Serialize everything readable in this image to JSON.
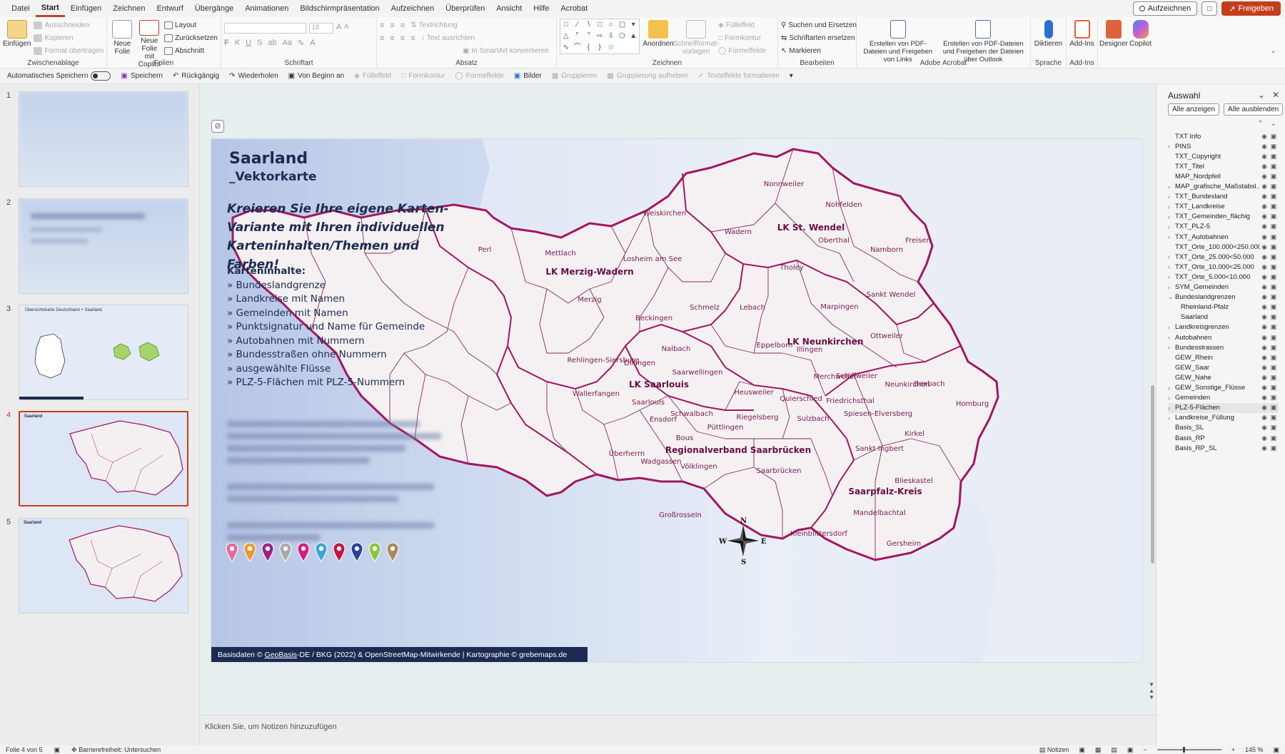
{
  "menu": {
    "tabs": [
      "Datei",
      "Start",
      "Einfügen",
      "Zeichnen",
      "Entwurf",
      "Übergänge",
      "Animationen",
      "Bildschirmpräsentation",
      "Aufzeichnen",
      "Überprüfen",
      "Ansicht",
      "Hilfe",
      "Acrobat"
    ],
    "active_tab": "Start",
    "record_label": "Aufzeichnen",
    "share_label": "Freigeben"
  },
  "ribbon": {
    "clipboard": {
      "paste": "Einfügen",
      "cut": "Ausschneiden",
      "copy": "Kopieren",
      "format_painter": "Format übertragen",
      "group": "Zwischenablage"
    },
    "slides": {
      "new_slide": "Neue Folie",
      "new_slide_copilot": "Neue Folie mit Copilot",
      "layout": "Layout",
      "reset": "Zurücksetzen",
      "section": "Abschnitt",
      "group": "Folien"
    },
    "font": {
      "size": "18",
      "group": "Schriftart"
    },
    "paragraph": {
      "text_direction": "Textrichtung",
      "align_text": "Text ausrichten",
      "smartart": "In SmartArt konvertieren",
      "group": "Absatz"
    },
    "drawing": {
      "arrange": "Anordnen",
      "quick_styles": "Schnellformat-vorlagen",
      "fill": "Fülleffekt",
      "outline": "Formkontur",
      "effects": "Formeffekte",
      "group": "Zeichnen"
    },
    "editing": {
      "find_replace": "Suchen und Ersetzen",
      "replace_fonts": "Schriftarten ersetzen",
      "select": "Markieren",
      "group": "Bearbeiten"
    },
    "acrobat": {
      "pdf_links": "Erstellen von PDF-Dateien und Freigeben von Links",
      "pdf_outlook": "Erstellen von PDF-Dateien und Freigeben der Dateien über Outlook",
      "group": "Adobe Acrobat"
    },
    "voice": {
      "dictate": "Diktieren",
      "group": "Sprache"
    },
    "addins": {
      "addins": "Add-Ins",
      "group": "Add-Ins"
    },
    "designer": "Designer",
    "copilot": "Copilot"
  },
  "qat": {
    "autosave": "Automatisches Speichern",
    "save": "Speichern",
    "undo": "Rückgängig",
    "redo": "Wiederholen",
    "from_start": "Von Beginn an",
    "fill": "Fülleffekt",
    "outline": "Formkontur",
    "effects": "Formeffekte",
    "pictures": "Bilder",
    "group": "Gruppieren",
    "ungroup": "Gruppierung aufheben",
    "text_effects": "Texteffekte formatieren"
  },
  "thumbnails": {
    "numbers": [
      "1",
      "2",
      "3",
      "4",
      "5"
    ],
    "slide3_title": "Übersichtskarte Deutschland + Saarland",
    "slide4_title": "Saarland",
    "slide5_title": "Saarland"
  },
  "slide": {
    "title": "Saarland",
    "subtitle": "_Vektorkarte",
    "slogan": "Kreieren Sie Ihre eigene Karten-Variante mit Ihren individuellen Karteninhalten/Themen und Farben!",
    "list_head": "Karteninhalte:",
    "list": [
      "» Bundeslandgrenze",
      "» Landkreise mit Namen",
      "» Gemeinden mit Namen",
      "» Punktsignatur und Name für Gemeinde",
      "» Autobahnen mit Nummern",
      "» Bundesstraßen ohne Nummern",
      "» ausgewählte Flüsse",
      "» PLZ-5-Flächen mit PLZ-5-Nummern"
    ],
    "footer_pre": "Basisdaten © ",
    "footer_link": "GeoBasis",
    "footer_post": "-DE / BKG (2022) & OpenStreetMap-Mitwirkende | Kartographie © grebemaps.de",
    "pin_colors": [
      "#e36b9a",
      "#f0962c",
      "#a0217e",
      "#a9a9a9",
      "#d81b7c",
      "#3aa6d6",
      "#c8153e",
      "#2e3f9e",
      "#8cc63f",
      "#a88a5a"
    ],
    "compass": {
      "n": "N",
      "s": "S",
      "w": "W",
      "e": "E"
    },
    "districts": [
      "LK Merzig-Wadern",
      "LK St. Wendel",
      "LK Neunkirchen",
      "LK Saarlouis",
      "Regionalverband Saarbrücken",
      "Saarpfalz-Kreis"
    ],
    "municipalities": [
      "Perl",
      "Mettlach",
      "Weiskirchen",
      "Wadern",
      "Nonnweiler",
      "Nohfelden",
      "Losheim am See",
      "Oberthal",
      "Namborn",
      "Freisen",
      "Merzig",
      "Tholey",
      "Sankt Wendel",
      "Beckingen",
      "Schmelz",
      "Lebach",
      "Marpingen",
      "Eppelborn",
      "Ottweiler",
      "Illingen",
      "Nalbach",
      "Rehlingen-Siersburg",
      "Dillingen",
      "Saarwellingen",
      "Merchweiler",
      "Schiffweiler",
      "Wallerfangen",
      "Heusweiler",
      "Neunkirchen",
      "Bexbach",
      "Saarlouis",
      "Quierschied",
      "Friedrichsthal",
      "Homburg",
      "Schwalbach",
      "Ensdorf",
      "Spiesen-Elversberg",
      "Püttlingen",
      "Riegelsberg",
      "Sulzbach",
      "Bous",
      "Überherrn",
      "Sankt Ingbert",
      "Kirkel",
      "Wadgassen",
      "Völklingen",
      "Saarbrücken",
      "Blieskastel",
      "Großrosseln",
      "Mandelbachtal",
      "Kleinblittersdorf",
      "Gersheim"
    ]
  },
  "notes": {
    "placeholder": "Klicken Sie, um Notizen hinzuzufügen"
  },
  "selection_pane": {
    "title": "Auswahl",
    "show_all": "Alle anzeigen",
    "hide_all": "Alle ausblenden",
    "layers": [
      {
        "name": "TXT Info",
        "expandable": false,
        "indent": 0
      },
      {
        "name": "PINS",
        "expandable": true,
        "indent": 0
      },
      {
        "name": "TXT_Copyright",
        "expandable": false,
        "indent": 0
      },
      {
        "name": "TXT_Titel",
        "expandable": false,
        "indent": 0
      },
      {
        "name": "MAP_Nordpfeil",
        "expandable": false,
        "indent": 0
      },
      {
        "name": "MAP_grafische_Maßstabsl...",
        "expandable": true,
        "indent": 0
      },
      {
        "name": "TXT_Bundesland",
        "expandable": true,
        "indent": 0
      },
      {
        "name": "TXT_Landkreise",
        "expandable": true,
        "indent": 0
      },
      {
        "name": "TXT_Gemeinden_flächig",
        "expandable": true,
        "indent": 0
      },
      {
        "name": "TXT_PLZ-5",
        "expandable": true,
        "indent": 0
      },
      {
        "name": "TXT_Autobahnen",
        "expandable": true,
        "indent": 0
      },
      {
        "name": "TXT_Orte_100.000<250.000",
        "expandable": false,
        "indent": 0
      },
      {
        "name": "TXT_Orte_25.000<50.000",
        "expandable": true,
        "indent": 0
      },
      {
        "name": "TXT_Orte_10.000<25.000",
        "expandable": true,
        "indent": 0
      },
      {
        "name": "TXT_Orte_5.000<10.000",
        "expandable": true,
        "indent": 0
      },
      {
        "name": "SYM_Gemeinden",
        "expandable": true,
        "indent": 0
      },
      {
        "name": "Bundeslandgrenzen",
        "expandable": true,
        "expanded": true,
        "indent": 0
      },
      {
        "name": "Rheinland-Pfalz",
        "expandable": false,
        "indent": 1
      },
      {
        "name": "Saarland",
        "expandable": false,
        "indent": 1
      },
      {
        "name": "Landkreisgrenzen",
        "expandable": true,
        "indent": 0
      },
      {
        "name": "Autobahnen",
        "expandable": true,
        "indent": 0
      },
      {
        "name": "Bundesstrassen",
        "expandable": true,
        "indent": 0
      },
      {
        "name": "GEW_Rhein",
        "expandable": false,
        "indent": 0
      },
      {
        "name": "GEW_Saar",
        "expandable": false,
        "indent": 0
      },
      {
        "name": "GEW_Nahe",
        "expandable": false,
        "indent": 0
      },
      {
        "name": "GEW_Sonstige_Flüsse",
        "expandable": true,
        "indent": 0
      },
      {
        "name": "Gemeinden",
        "expandable": true,
        "indent": 0
      },
      {
        "name": "PLZ-5-Flächen",
        "expandable": true,
        "indent": 0,
        "highlight": true
      },
      {
        "name": "Landkreise_Füllung",
        "expandable": true,
        "indent": 0
      },
      {
        "name": "Basis_SL",
        "expandable": false,
        "indent": 0
      },
      {
        "name": "Basis_RP",
        "expandable": false,
        "indent": 0
      },
      {
        "name": "Basis_RP_SL",
        "expandable": false,
        "indent": 0
      }
    ]
  },
  "status": {
    "slide_of": "Folie 4 von 5",
    "accessibility": "Barrierefreiheit: Untersuchen",
    "notes": "Notizen",
    "zoom": "145 %"
  },
  "colors": {
    "accent": "#c43e1c",
    "border": "#a3175f",
    "label": "#7a1a4e",
    "navy": "#1d2b52"
  }
}
